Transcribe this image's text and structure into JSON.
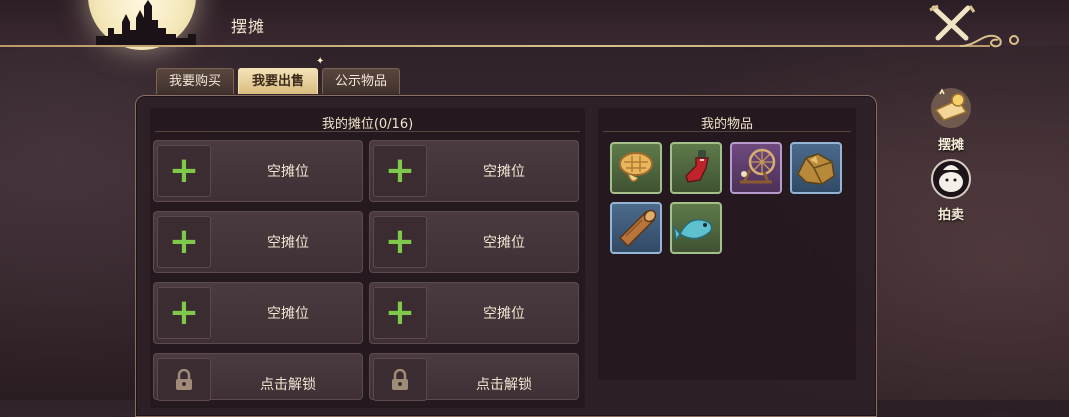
{
  "header": {
    "title": "摆摊"
  },
  "tabs": [
    {
      "label": "我要购买",
      "active": false
    },
    {
      "label": "我要出售",
      "active": true
    },
    {
      "label": "公示物品",
      "active": false
    }
  ],
  "stall": {
    "title": "我的摊位(0/16)",
    "slots": [
      {
        "label": "空摊位",
        "icon": "plus-icon"
      },
      {
        "label": "空摊位",
        "icon": "plus-icon"
      },
      {
        "label": "空摊位",
        "icon": "plus-icon"
      },
      {
        "label": "空摊位",
        "icon": "plus-icon"
      },
      {
        "label": "空摊位",
        "icon": "plus-icon"
      },
      {
        "label": "空摊位",
        "icon": "plus-icon"
      },
      {
        "label": "点击解锁",
        "icon": "lock-icon"
      },
      {
        "label": "点击解锁",
        "icon": "lock-icon"
      }
    ]
  },
  "inventory": {
    "title": "我的物品",
    "items": [
      {
        "icon": "pie-food-icon",
        "rarity": "green"
      },
      {
        "icon": "potion-bottle-icon",
        "rarity": "green"
      },
      {
        "icon": "spinning-wheel-icon",
        "rarity": "purple"
      },
      {
        "icon": "gold-ore-icon",
        "rarity": "blue"
      },
      {
        "icon": "wood-log-icon",
        "rarity": "blue"
      },
      {
        "icon": "fish-icon",
        "rarity": "green"
      }
    ]
  },
  "side_nav": [
    {
      "label": "摆摊",
      "icon": "stall-icon",
      "active": true
    },
    {
      "label": "拍卖",
      "icon": "auction-icon",
      "active": false
    }
  ],
  "colors": {
    "accent_gold": "#d9bc7f",
    "plus_green": "#7ec84a",
    "rarity_green": "#a4c08c",
    "rarity_purple": "#b69acb",
    "rarity_blue": "#96b4d6"
  }
}
